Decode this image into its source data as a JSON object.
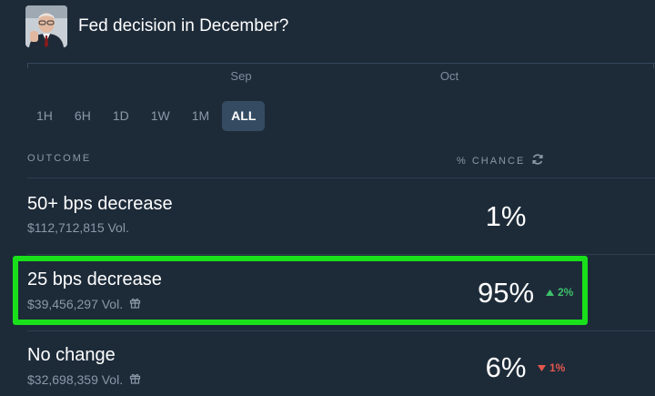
{
  "market": {
    "title": "Fed decision in December?"
  },
  "chart": {
    "months": [
      "Sep",
      "Oct"
    ]
  },
  "time_ranges": [
    "1H",
    "6H",
    "1D",
    "1W",
    "1M",
    "ALL"
  ],
  "selected_range": "ALL",
  "table": {
    "outcome_header": "OUTCOME",
    "chance_header": "% CHANCE",
    "rows": [
      {
        "name": "50+ bps decrease",
        "volume": "$112,712,815 Vol.",
        "chance": "1%",
        "delta": "",
        "direction": "none",
        "gift": false
      },
      {
        "name": "25 bps decrease",
        "volume": "$39,456,297 Vol.",
        "chance": "95%",
        "delta": "2%",
        "direction": "up",
        "gift": true
      },
      {
        "name": "No change",
        "volume": "$32,698,359 Vol.",
        "chance": "6%",
        "delta": "1%",
        "direction": "down",
        "gift": true
      }
    ]
  },
  "colors": {
    "background": "#1d2b39",
    "highlight": "#19e01a",
    "up": "#3fbf6a",
    "down": "#e2574c"
  }
}
